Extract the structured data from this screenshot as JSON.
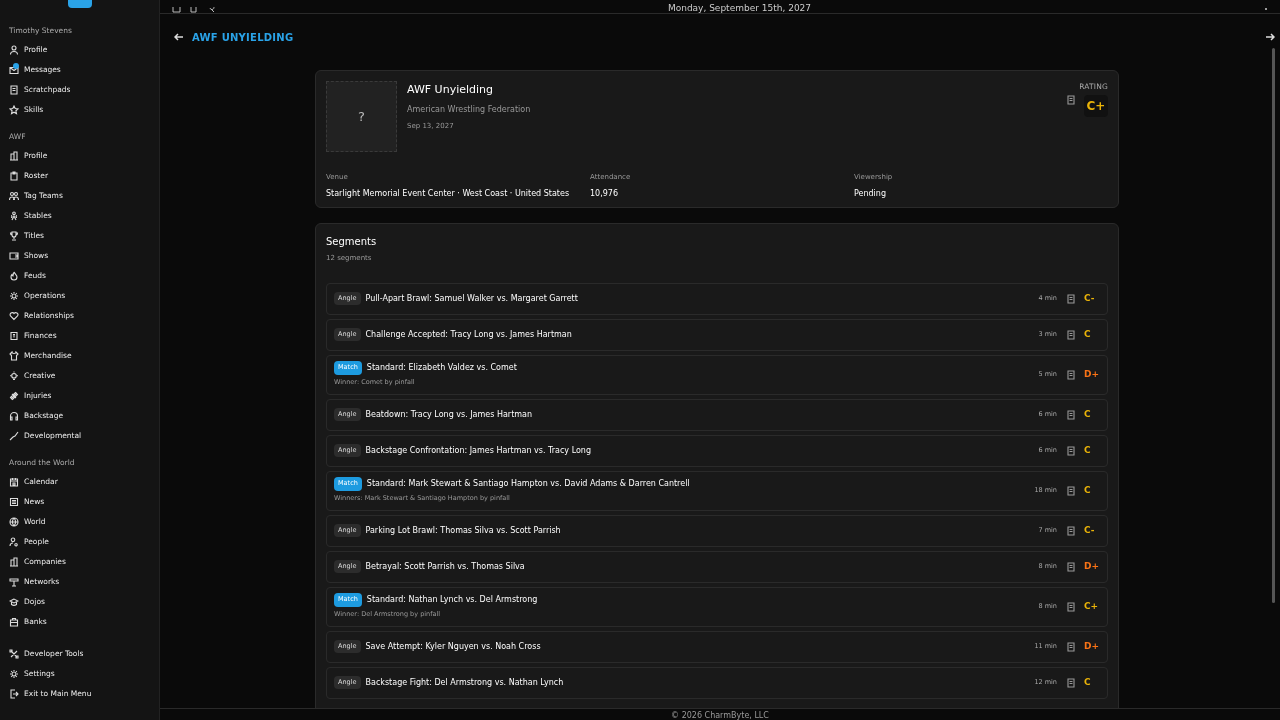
{
  "topbar": {
    "date": "Monday, September 15th, 2027"
  },
  "sidebar": {
    "sections": [
      {
        "title": "Timothy Stevens",
        "items": [
          {
            "label": "Profile"
          },
          {
            "label": "Messages",
            "badge": true
          },
          {
            "label": "Scratchpads"
          },
          {
            "label": "Skills"
          }
        ]
      },
      {
        "title": "AWF",
        "items": [
          {
            "label": "Profile"
          },
          {
            "label": "Roster"
          },
          {
            "label": "Tag Teams"
          },
          {
            "label": "Stables"
          },
          {
            "label": "Titles"
          },
          {
            "label": "Shows"
          },
          {
            "label": "Feuds"
          },
          {
            "label": "Operations"
          },
          {
            "label": "Relationships"
          },
          {
            "label": "Finances"
          },
          {
            "label": "Merchandise"
          },
          {
            "label": "Creative"
          },
          {
            "label": "Injuries"
          },
          {
            "label": "Backstage"
          },
          {
            "label": "Developmental"
          }
        ]
      },
      {
        "title": "Around the World",
        "items": [
          {
            "label": "Calendar"
          },
          {
            "label": "News"
          },
          {
            "label": "World"
          },
          {
            "label": "People"
          },
          {
            "label": "Companies"
          },
          {
            "label": "Networks"
          },
          {
            "label": "Dojos"
          },
          {
            "label": "Banks"
          }
        ]
      },
      {
        "items": [
          {
            "label": "Developer Tools"
          },
          {
            "label": "Settings"
          },
          {
            "label": "Exit to Main Menu"
          }
        ]
      }
    ]
  },
  "page_title": "AWF UNYIELDING",
  "show": {
    "placeholder_mark": "?",
    "name": "AWF Unyielding",
    "company": "American Wrestling Federation",
    "date": "Sep 13, 2027",
    "rating_label": "RATING",
    "rating": "C+",
    "stats": [
      {
        "label": "Venue",
        "value": "Starlight Memorial Event Center · West Coast · United States"
      },
      {
        "label": "Attendance",
        "value": "10,976"
      },
      {
        "label": "Viewership",
        "value": "Pending"
      }
    ]
  },
  "segments": {
    "title": "Segments",
    "count": "12 segments",
    "items": [
      {
        "kind": "angle",
        "tag": "Angle",
        "title": "Pull-Apart Brawl: Samuel Walker vs. Margaret Garrett",
        "duration": "4 min",
        "grade": "C-",
        "color": "#eab308"
      },
      {
        "kind": "angle",
        "tag": "Angle",
        "title": "Challenge Accepted: Tracy Long vs. James Hartman",
        "duration": "3 min",
        "grade": "C",
        "color": "#eab308"
      },
      {
        "kind": "match",
        "tag": "Match",
        "title": "Standard: Elizabeth Valdez vs. Comet",
        "result": "Winner: Comet by pinfall",
        "duration": "5 min",
        "grade": "D+",
        "color": "#f97316"
      },
      {
        "kind": "angle",
        "tag": "Angle",
        "title": "Beatdown: Tracy Long vs. James Hartman",
        "duration": "6 min",
        "grade": "C",
        "color": "#eab308"
      },
      {
        "kind": "angle",
        "tag": "Angle",
        "title": "Backstage Confrontation: James Hartman vs. Tracy Long",
        "duration": "6 min",
        "grade": "C",
        "color": "#eab308"
      },
      {
        "kind": "match",
        "tag": "Match",
        "title": "Standard: Mark Stewart & Santiago Hampton vs. David Adams & Darren Cantrell",
        "result": "Winners: Mark Stewart & Santiago Hampton by pinfall",
        "duration": "18 min",
        "grade": "C",
        "color": "#eab308"
      },
      {
        "kind": "angle",
        "tag": "Angle",
        "title": "Parking Lot Brawl: Thomas Silva vs. Scott Parrish",
        "duration": "7 min",
        "grade": "C-",
        "color": "#eab308"
      },
      {
        "kind": "angle",
        "tag": "Angle",
        "title": "Betrayal: Scott Parrish vs. Thomas Silva",
        "duration": "8 min",
        "grade": "D+",
        "color": "#f97316"
      },
      {
        "kind": "match",
        "tag": "Match",
        "title": "Standard: Nathan Lynch vs. Del Armstrong",
        "result": "Winner: Del Armstrong by pinfall",
        "duration": "8 min",
        "grade": "C+",
        "color": "#eab308"
      },
      {
        "kind": "angle",
        "tag": "Angle",
        "title": "Save Attempt: Kyler Nguyen vs. Noah Cross",
        "duration": "11 min",
        "grade": "D+",
        "color": "#f97316"
      },
      {
        "kind": "angle",
        "tag": "Angle",
        "title": "Backstage Fight: Del Armstrong vs. Nathan Lynch",
        "duration": "12 min",
        "grade": "C",
        "color": "#eab308"
      }
    ]
  },
  "footer": "© 2026 CharmByte, LLC"
}
